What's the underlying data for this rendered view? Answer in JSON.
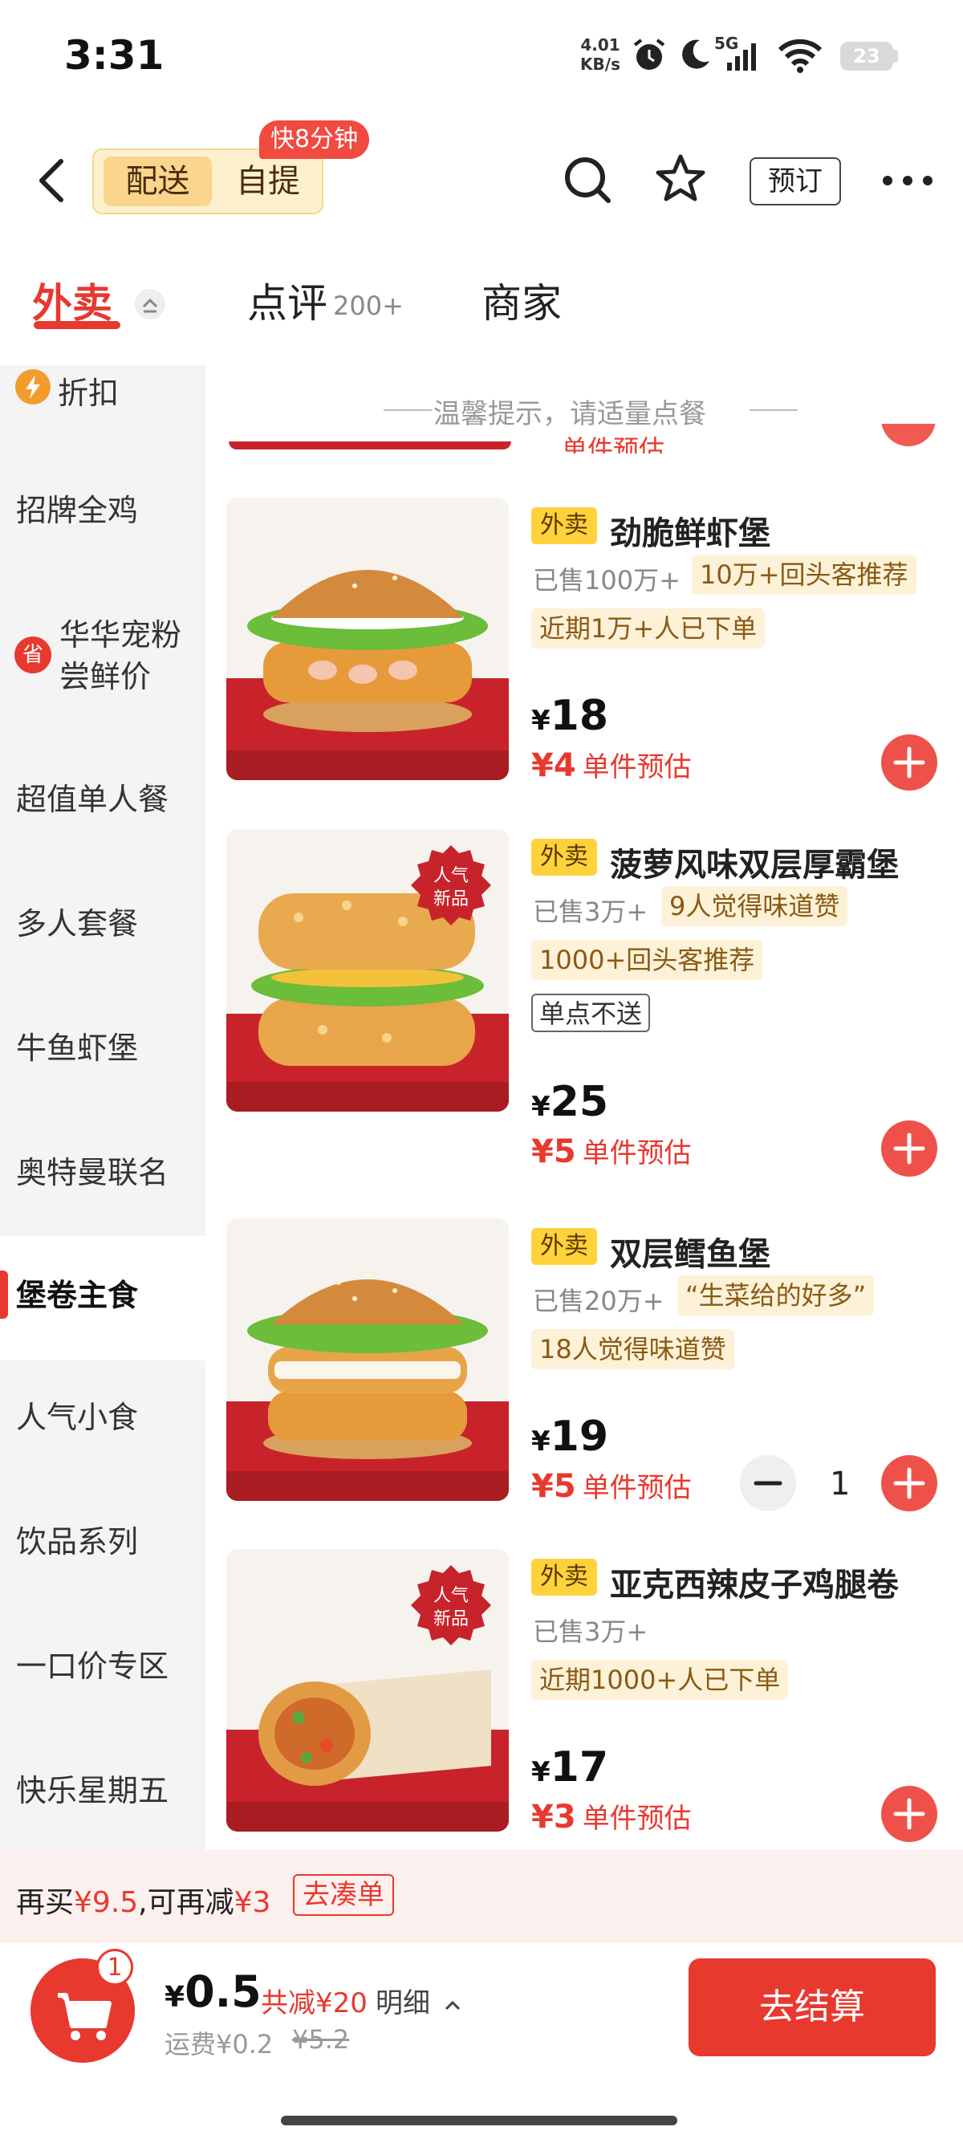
{
  "status_bar": {
    "time": "3:31",
    "net_speed_value": "4.01",
    "net_speed_unit": "KB/s",
    "network_label": "5G",
    "battery": "23"
  },
  "header": {
    "mode_delivery": "配送",
    "mode_pickup": "自提",
    "speed_badge": "快8分钟",
    "reserve_label": "预订"
  },
  "tabs": {
    "takeout": "外卖",
    "reviews": "点评",
    "reviews_count": "200+",
    "merchant": "商家"
  },
  "sidebar": {
    "items": [
      {
        "label": "折扣"
      },
      {
        "label": "招牌全鸡"
      },
      {
        "label": "华华宠粉尝鲜价"
      },
      {
        "label": "超值单人餐"
      },
      {
        "label": "多人套餐"
      },
      {
        "label": "牛鱼虾堡"
      },
      {
        "label": "奥特曼联名"
      },
      {
        "label": "堡卷主食"
      },
      {
        "label": "人气小食"
      },
      {
        "label": "饮品系列"
      },
      {
        "label": "一口价专区"
      },
      {
        "label": "快乐星期五"
      }
    ],
    "discount_badge": "省"
  },
  "tip": "温馨提示，请适量点餐",
  "partial_text": "单件预估",
  "products": [
    {
      "tag": "外卖",
      "name": "劲脆鲜虾堡",
      "sold": "已售100万+",
      "tags": [
        "10万+回头客推荐",
        "近期1万+人已下单"
      ],
      "price": "18",
      "estimate": "4",
      "estimate_label": "单件预估"
    },
    {
      "tag": "外卖",
      "name": "菠萝风味双层厚霸堡",
      "sold": "已售3万+",
      "tags": [
        "9人觉得味道赞",
        "1000+回头客推荐"
      ],
      "plain_tag": "单点不送",
      "price": "25",
      "estimate": "5",
      "estimate_label": "单件预估",
      "badge_line1": "人气",
      "badge_line2": "新品"
    },
    {
      "tag": "外卖",
      "name": "双层鳕鱼堡",
      "sold": "已售20万+",
      "tags": [
        "“生菜给的好多”",
        "18人觉得味道赞"
      ],
      "price": "19",
      "estimate": "5",
      "estimate_label": "单件预估",
      "quantity": "1"
    },
    {
      "tag": "外卖",
      "name": "亚克西辣皮子鸡腿卷",
      "sold": "已售3万+",
      "tags": [
        "近期1000+人已下单"
      ],
      "price": "17",
      "estimate": "3",
      "estimate_label": "单件预估",
      "badge_line1": "人气",
      "badge_line2": "新品"
    }
  ],
  "currency": "¥",
  "promo": {
    "prefix": "再买",
    "amount1": "¥9.5",
    "middle": ",可再减",
    "amount2": "¥3",
    "button": "去凑单"
  },
  "bottom": {
    "cart_count": "1",
    "total": "0.5",
    "saved": "共减¥20",
    "detail": "明细",
    "delivery_fee": "运费¥0.2",
    "original_fee": "¥5.2",
    "checkout": "去结算"
  },
  "colors": {
    "accent": "#e8392f",
    "tag_yellow": "#ffd23c",
    "tag_bg": "#fdf1d8",
    "sidebar_bg": "#f4f4f4"
  }
}
